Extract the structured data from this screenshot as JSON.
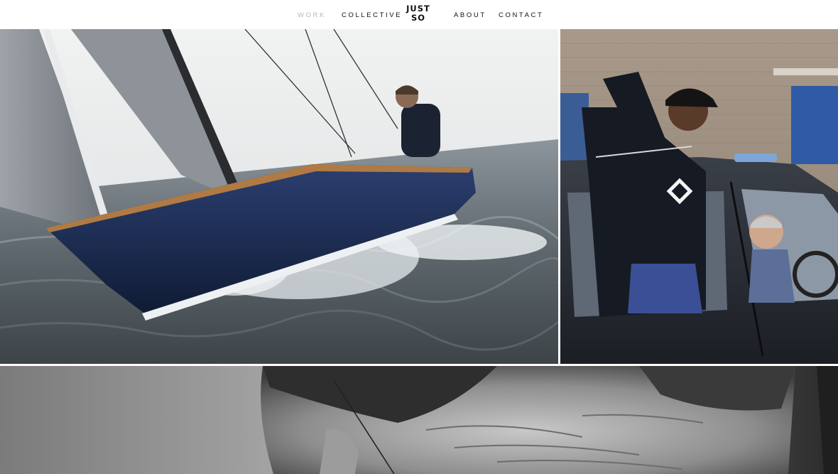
{
  "nav": {
    "work_label": "WORK",
    "collective_label": "COLLECTIVE",
    "about_label": "ABOUT",
    "contact_label": "CONTACT"
  },
  "logo": {
    "line1": "JUST",
    "line2": "SO"
  },
  "colors": {
    "background": "#ffffff",
    "nav_text": "#111111",
    "nav_active": "#b9b9b9"
  },
  "tiles": [
    {
      "name": "sailing-project-tile",
      "subject": "sailboat"
    },
    {
      "name": "taxi-project-tile",
      "subject": "taxi"
    },
    {
      "name": "portrait-project-tile",
      "subject": "portrait"
    }
  ]
}
